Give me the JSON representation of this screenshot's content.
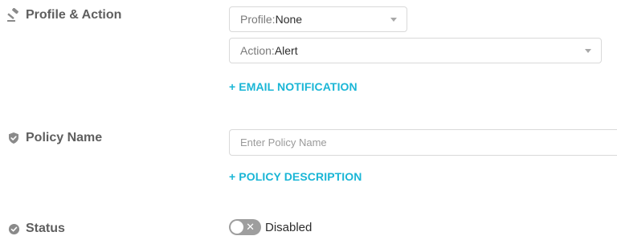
{
  "profile_action": {
    "label": "Profile & Action",
    "icon": "gavel-icon",
    "profile_select": {
      "prefix": "Profile: ",
      "value": "None"
    },
    "action_select": {
      "prefix": "Action: ",
      "value": "Alert"
    },
    "email_link": "+ EMAIL NOTIFICATION"
  },
  "policy_name": {
    "label": "Policy Name",
    "icon": "shield-icon",
    "input_placeholder": "Enter Policy Name",
    "input_value": "",
    "description_link": "+ POLICY DESCRIPTION"
  },
  "status": {
    "label": "Status",
    "icon": "check-circle-icon",
    "toggle_label": "Disabled",
    "enabled": false
  },
  "colors": {
    "accent_link": "#1ab6d6",
    "toggle_off": "#9e9e9e",
    "label_text": "#5f5f5f"
  }
}
